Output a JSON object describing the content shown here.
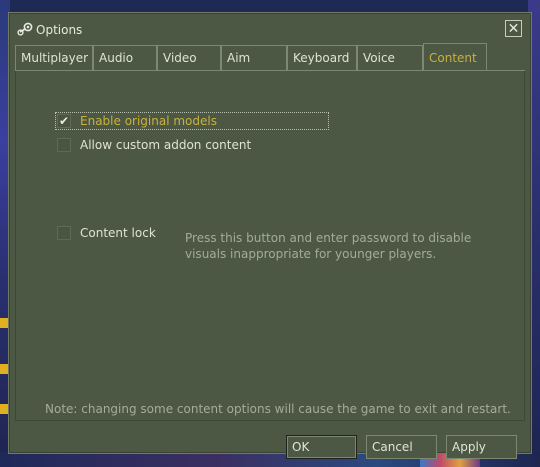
{
  "window": {
    "title": "Options",
    "close_glyph": "✕"
  },
  "tabs": [
    {
      "label": "Multiplayer"
    },
    {
      "label": "Audio"
    },
    {
      "label": "Video"
    },
    {
      "label": "Aim"
    },
    {
      "label": "Keyboard"
    },
    {
      "label": "Voice"
    },
    {
      "label": "Content",
      "active": true
    }
  ],
  "content": {
    "enable_original_models": {
      "label": "Enable original models",
      "checked": true
    },
    "allow_custom_addon": {
      "label": "Allow custom addon content",
      "checked": false
    },
    "content_lock": {
      "label": "Content lock",
      "checked": false
    },
    "content_lock_description": "Press this button and enter password to disable visuals inappropriate for younger players.",
    "note": "Note: changing some content options will cause the game to exit and restart."
  },
  "buttons": {
    "ok": "OK",
    "cancel": "Cancel",
    "apply": "Apply"
  },
  "colors": {
    "panel": "#4c5844",
    "accent_text": "#c9b13c",
    "muted_text": "#a4ac98"
  },
  "icons": {
    "app": "steam-icon",
    "check": "checkmark-icon",
    "close": "close-icon"
  }
}
